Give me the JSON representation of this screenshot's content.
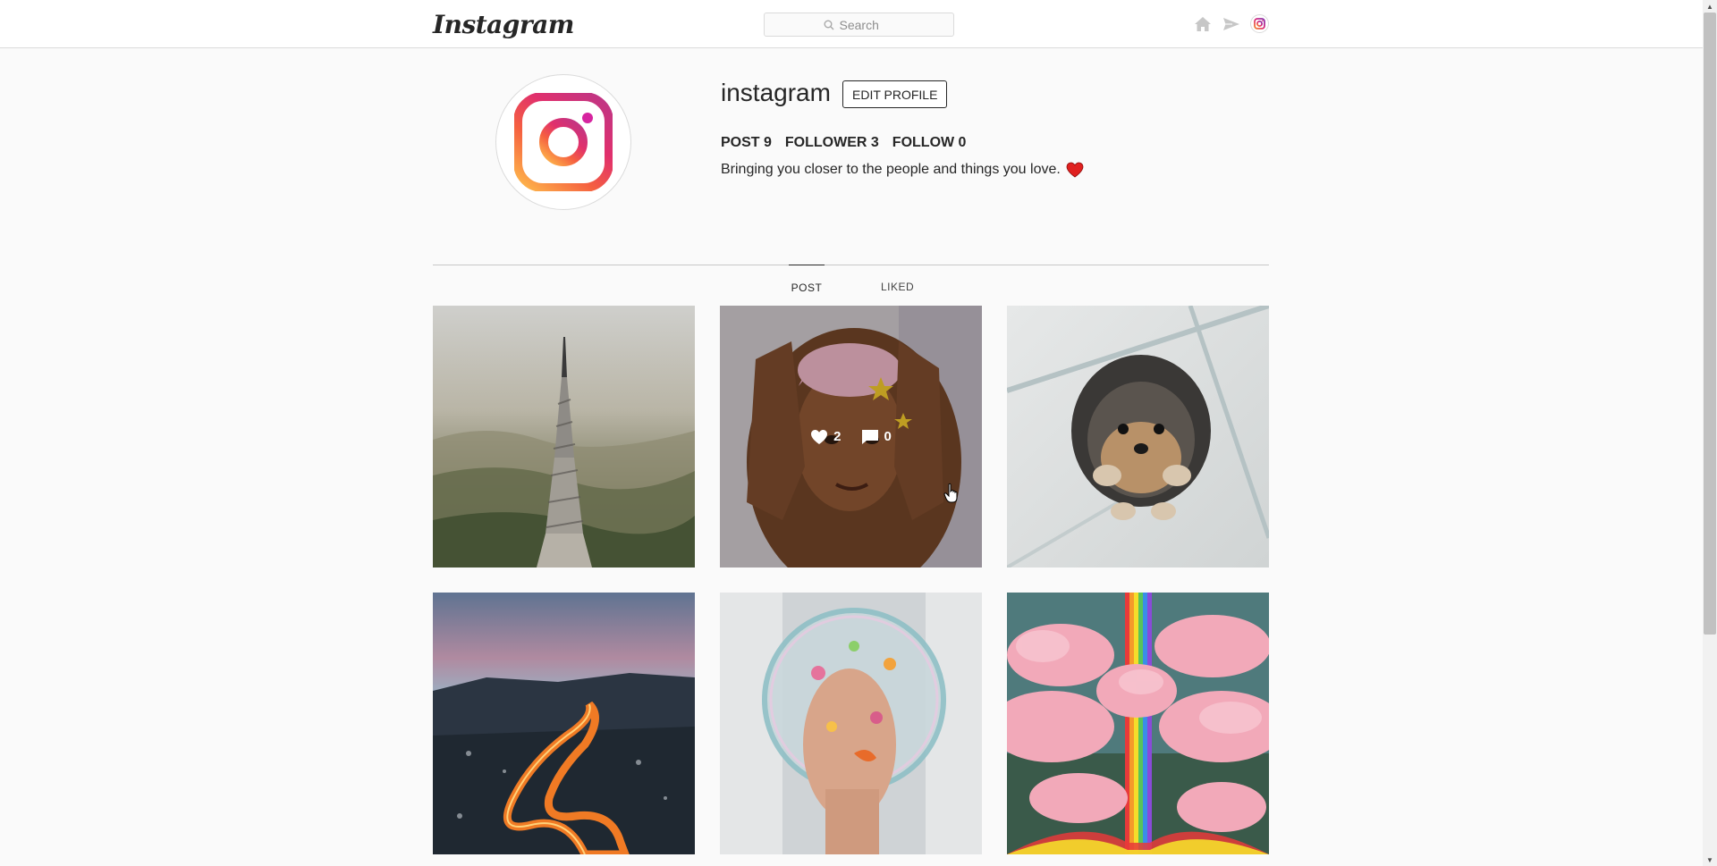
{
  "header": {
    "logo_text": "Instagram",
    "search_placeholder": "Search",
    "icons": [
      "home-icon",
      "direct-icon",
      "instagram-profile-icon"
    ]
  },
  "profile": {
    "username": "instagram",
    "edit_label": "EDIT PROFILE",
    "stats": {
      "post": "POST 9",
      "follower": "FOLLOWER 3",
      "follow": "FOLLOW 0"
    },
    "bio": "Bringing you closer to the people and things you love."
  },
  "tabs": [
    {
      "label": "POST",
      "active": true
    },
    {
      "label": "LIKED",
      "active": false
    }
  ],
  "posts": [
    {
      "subject": "pagoda-tower-misty-mountains"
    },
    {
      "subject": "woman-framing-face-with-hands",
      "hover": true,
      "likes": "2",
      "comments": "0"
    },
    {
      "subject": "pomeranian-dog-on-glass"
    },
    {
      "subject": "winding-road-light-trails"
    },
    {
      "subject": "hand-in-bubble-with-fish"
    },
    {
      "subject": "rainbow-river-pink-clouds"
    }
  ],
  "colors": {
    "brand_pink": "#e1306c",
    "brand_orange": "#f58529",
    "heart_red": "#ed4956"
  }
}
